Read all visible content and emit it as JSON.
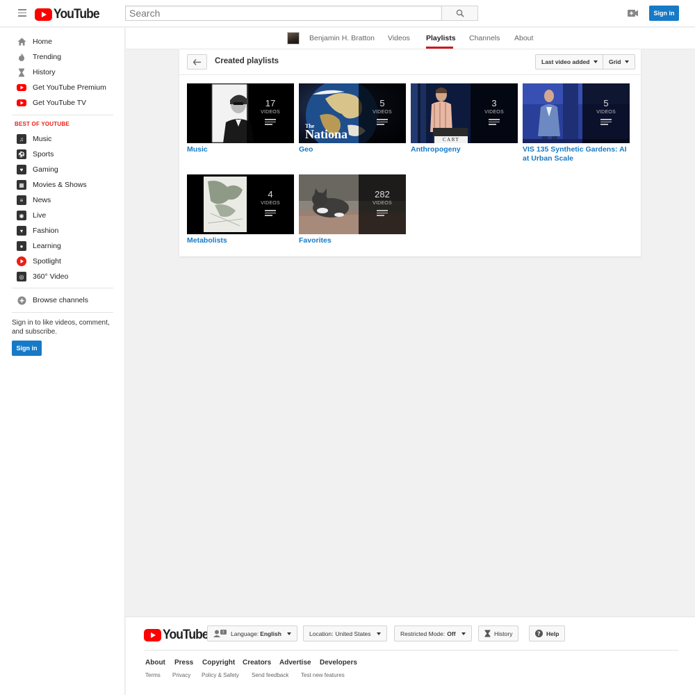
{
  "masthead": {
    "logo_text": "YouTube",
    "search_placeholder": "Search",
    "signin_label": "Sign in"
  },
  "sidebar": {
    "items": [
      {
        "label": "Home",
        "icon": "home-icon"
      },
      {
        "label": "Trending",
        "icon": "flame-icon"
      },
      {
        "label": "History",
        "icon": "hourglass-icon"
      },
      {
        "label": "Get YouTube Premium",
        "icon": "youtube-red-icon"
      },
      {
        "label": "Get YouTube TV",
        "icon": "youtube-red-icon"
      }
    ],
    "best_title": "BEST OF YOUTUBE",
    "best_items": [
      {
        "label": "Music",
        "icon": "music-icon"
      },
      {
        "label": "Sports",
        "icon": "sports-icon"
      },
      {
        "label": "Gaming",
        "icon": "gaming-icon"
      },
      {
        "label": "Movies & Shows",
        "icon": "movies-icon"
      },
      {
        "label": "News",
        "icon": "news-icon"
      },
      {
        "label": "Live",
        "icon": "live-icon"
      },
      {
        "label": "Fashion",
        "icon": "fashion-icon"
      },
      {
        "label": "Learning",
        "icon": "learning-icon"
      },
      {
        "label": "Spotlight",
        "icon": "spotlight-icon"
      },
      {
        "label": "360° Video",
        "icon": "vr-icon"
      }
    ],
    "browse_label": "Browse channels",
    "signin_text": "Sign in to like videos, comment, and subscribe.",
    "signin_label": "Sign in"
  },
  "channel": {
    "name": "Benjamin H. Bratton",
    "tabs": [
      "Videos",
      "Playlists",
      "Channels",
      "About"
    ],
    "active_tab": "Playlists"
  },
  "playlists_section": {
    "title": "Created playlists",
    "sort_label": "Last video added",
    "view_label": "Grid",
    "items": [
      {
        "title": "Music",
        "count": "17",
        "unit": "VIDEOS"
      },
      {
        "title": "Geo",
        "count": "5",
        "unit": "VIDEOS",
        "thumb_text_small": "The",
        "thumb_text": "Nationa"
      },
      {
        "title": "Anthropogeny",
        "count": "3",
        "unit": "VIDEOS",
        "thumb_text": "CART"
      },
      {
        "title": "VIS 135 Synthetic Gardens: AI at Urban Scale",
        "count": "5",
        "unit": "VIDEOS"
      },
      {
        "title": "Metabolists",
        "count": "4",
        "unit": "VIDEOS"
      },
      {
        "title": "Favorites",
        "count": "282",
        "unit": "VIDEOS"
      }
    ]
  },
  "footer": {
    "logo_text": "YouTube",
    "language_label": "Language:",
    "language_value": "English",
    "location_label": "Location:",
    "location_value": "United States",
    "restricted_label": "Restricted Mode:",
    "restricted_value": "Off",
    "history_label": "History",
    "help_label": "Help",
    "links": [
      "About",
      "Press",
      "Copyright",
      "Creators",
      "Advertise",
      "Developers"
    ],
    "sublinks": [
      "Terms",
      "Privacy",
      "Policy & Safety",
      "Send feedback",
      "Test new features"
    ]
  },
  "colors": {
    "brand_red": "#ff0000",
    "link_blue": "#167ac6",
    "section_red": "#e62117"
  }
}
